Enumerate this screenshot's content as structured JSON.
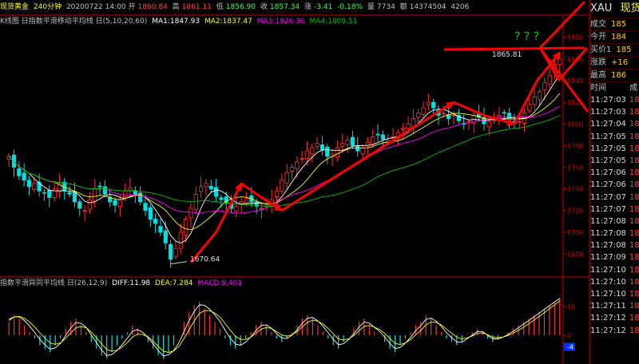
{
  "header": {
    "instrument": "现货黄金",
    "period": "240分钟",
    "date_time": "20200722 14:00",
    "open_label": "开",
    "open": "1860.84",
    "high_label": "高",
    "high": "1861.11",
    "low_label": "低",
    "low": "1856.90",
    "close_label": "收",
    "close": "1857.34",
    "change_label": "涨",
    "change": "-3.41",
    "change_pct": "-0.18%",
    "vol_label": "量",
    "volume": "7734",
    "amount_label": "额",
    "amount": "14374504",
    "extra": "4206"
  },
  "ma_legend": {
    "title": "K线图 日指数平滑移动平均线 日(5,10,20,60)",
    "ma1": "MA1:1847.93",
    "ma2": "MA2:1837.47",
    "ma3": "MA3:1826.36",
    "ma4": "MA4:1809.51"
  },
  "macd_legend": {
    "title": "指数平滑异同平均线 日(26,12,9)",
    "diff": "DIFF:11.98",
    "dea": "DEA:7.284",
    "macd": "MACD:9.401"
  },
  "side_panel": {
    "symbol": "XAU",
    "name": "现货",
    "rows": [
      {
        "label": "成交",
        "value": "185"
      },
      {
        "label": "今开",
        "value": "184"
      },
      {
        "label": "买价1",
        "value": "185"
      },
      {
        "label": "涨跌",
        "value": "+16"
      },
      {
        "label": "最高",
        "value": "186"
      }
    ],
    "time_header": "时间",
    "value_header": "成",
    "ticks": [
      {
        "time": "11:27:03",
        "v": "18"
      },
      {
        "time": "11:27:03",
        "v": "18"
      },
      {
        "time": "11:27:04",
        "v": "18"
      },
      {
        "time": "11:27:05",
        "v": "18"
      },
      {
        "time": "11:27:05",
        "v": "18"
      },
      {
        "time": "11:27:05",
        "v": "18"
      },
      {
        "time": "11:27:06",
        "v": "18"
      },
      {
        "time": "11:27:06",
        "v": "18"
      },
      {
        "time": "11:27:07",
        "v": "18"
      },
      {
        "time": "11:27:07",
        "v": "18"
      },
      {
        "time": "11:27:08",
        "v": "18"
      },
      {
        "time": "11:27:08",
        "v": "18"
      },
      {
        "time": "11:27:08",
        "v": "18"
      },
      {
        "time": "11:27:09",
        "v": "18"
      },
      {
        "time": "11:27:10",
        "v": "18"
      },
      {
        "time": "11:27:10",
        "v": "18"
      },
      {
        "time": "11:27:10",
        "v": "18"
      },
      {
        "time": "11:27:11",
        "v": "18"
      },
      {
        "time": "11:27:12",
        "v": "18"
      },
      {
        "time": "11:27:12",
        "v": "18"
      }
    ]
  },
  "colors": {
    "up": "#ff3030",
    "down": "#00e0e0",
    "ma1": "#ffffff",
    "ma2": "#ffff00",
    "ma3": "#ff00ff",
    "ma4": "#00c000",
    "arrow": "#ff0000",
    "axis": "#cc0000",
    "question": "#00cc00"
  },
  "chart_data": [
    {
      "type": "candlestick",
      "title": "现货黄金 240分钟",
      "y_ticks": [
        1680,
        1700,
        1720,
        1740,
        1760,
        1780,
        1800,
        1820,
        1840,
        1860,
        1880
      ],
      "ylim": [
        1660,
        1888
      ],
      "annotations": [
        {
          "text": "1670.64",
          "kind": "low_marker",
          "value": 1670.64
        },
        {
          "text": "1865.81",
          "kind": "high_marker",
          "value": 1865.81
        },
        {
          "text": "? ? ?",
          "kind": "question_marks"
        }
      ],
      "trend_arrows_approx_price": [
        [
          1672,
          1700,
          1745
        ],
        [
          1745,
          1732,
          1720
        ],
        [
          1720,
          1770,
          1820
        ],
        [
          1820,
          1808,
          1800
        ],
        [
          1800,
          1840,
          1866
        ]
      ],
      "close_path": [
        1770,
        1760,
        1752,
        1748,
        1742,
        1745,
        1738,
        1736,
        1732,
        1740,
        1745,
        1738,
        1735,
        1728,
        1722,
        1720,
        1730,
        1740,
        1742,
        1735,
        1728,
        1725,
        1730,
        1738,
        1741,
        1735,
        1728,
        1720,
        1712,
        1708,
        1700,
        1690,
        1675,
        1685,
        1700,
        1712,
        1722,
        1735,
        1742,
        1745,
        1740,
        1733,
        1730,
        1727,
        1722,
        1724,
        1728,
        1731,
        1728,
        1724,
        1722,
        1725,
        1730,
        1738,
        1748,
        1755,
        1760,
        1765,
        1768,
        1775,
        1778,
        1782,
        1776,
        1770,
        1772,
        1778,
        1782,
        1785,
        1780,
        1775,
        1778,
        1783,
        1788,
        1790,
        1786,
        1785,
        1788,
        1792,
        1796,
        1800,
        1805,
        1810,
        1815,
        1820,
        1815,
        1808,
        1810,
        1805,
        1808,
        1803,
        1800,
        1802,
        1808,
        1806,
        1800,
        1802,
        1805,
        1808,
        1810,
        1805,
        1800,
        1802,
        1810,
        1818,
        1825,
        1830,
        1838,
        1845,
        1855,
        1860
      ],
      "ma_lines": [
        "MA1",
        "MA2",
        "MA3",
        "MA4"
      ]
    },
    {
      "type": "macd",
      "title": "指数平滑异同平均线 日(26,12,9)",
      "y_ticks": [
        10,
        0,
        -4
      ],
      "histogram": [
        4,
        6,
        5,
        3,
        1,
        -1,
        -3,
        -4,
        -5,
        -3,
        -1,
        2,
        4,
        5,
        3,
        1,
        -2,
        -4,
        -6,
        -7,
        -5,
        -3,
        -1,
        1,
        3,
        2,
        0,
        -2,
        -4,
        -6,
        -7,
        -5,
        -3,
        0,
        4,
        7,
        9,
        10,
        8,
        6,
        4,
        2,
        -1,
        -3,
        -4,
        -3,
        -1,
        1,
        3,
        4,
        3,
        1,
        -1,
        -2,
        -1,
        1,
        3,
        5,
        6,
        5,
        3,
        1,
        -1,
        -3,
        -4,
        -2,
        0,
        2,
        4,
        5,
        3,
        1,
        0,
        -2,
        -4,
        -5,
        -3,
        -1,
        1,
        3,
        4,
        6,
        5,
        3,
        1,
        -1,
        -2,
        -3,
        -2,
        0,
        1,
        2,
        1,
        -1,
        -2,
        -1,
        0,
        1,
        2,
        3,
        4,
        5,
        6,
        7,
        8,
        9,
        10,
        11
      ]
    }
  ]
}
